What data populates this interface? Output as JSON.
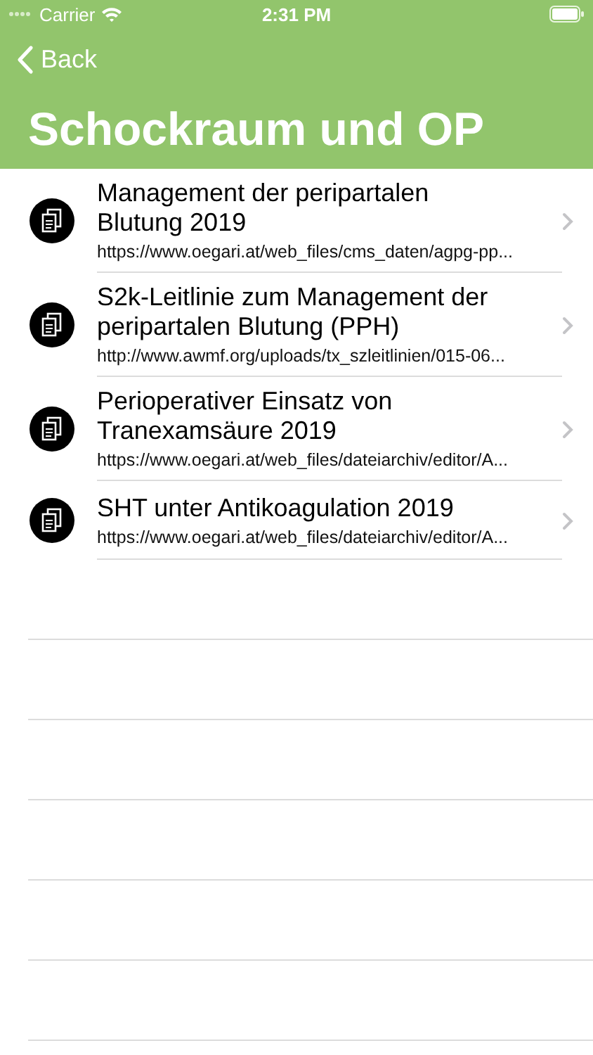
{
  "status_bar": {
    "carrier": "Carrier",
    "time": "2:31 PM"
  },
  "nav": {
    "back": "Back",
    "title": "Schockraum und OP"
  },
  "items": [
    {
      "title": "Management der peripartalen Blutung 2019",
      "url": "https://www.oegari.at/web_files/cms_daten/agpg-pp..."
    },
    {
      "title": "S2k-Leitlinie zum Management der peripartalen Blutung (PPH)",
      "url": "http://www.awmf.org/uploads/tx_szleitlinien/015-06..."
    },
    {
      "title": "Perioperativer Einsatz von Tranexamsäure 2019",
      "url": "https://www.oegari.at/web_files/dateiarchiv/editor/A..."
    },
    {
      "title": "SHT unter Antikoagulation 2019",
      "url": "https://www.oegari.at/web_files/dateiarchiv/editor/A..."
    }
  ]
}
